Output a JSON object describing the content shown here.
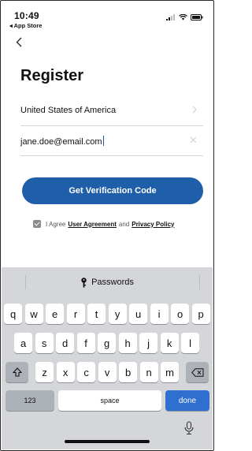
{
  "status_bar": {
    "time": "10:49",
    "back_app": "◂ App Store",
    "icons": [
      "signal-icon",
      "wifi-icon",
      "battery-icon"
    ]
  },
  "nav": {
    "back_icon": "chevron-left-icon"
  },
  "page": {
    "title": "Register"
  },
  "form": {
    "country": {
      "value": "United States of America",
      "trail_icon": "chevron-right-icon"
    },
    "email": {
      "value": "jane.doe@email.com",
      "trail_icon": "clear-icon"
    },
    "submit_label": "Get Verification Code"
  },
  "agreement": {
    "checked": true,
    "prefix": "I Agree",
    "link1": "User Agreement",
    "middle": "and",
    "link2": "Privacy Policy"
  },
  "keyboard": {
    "suggestion_bar": {
      "icon": "key-icon",
      "label": "Passwords"
    },
    "row1": [
      "q",
      "w",
      "e",
      "r",
      "t",
      "y",
      "u",
      "i",
      "o",
      "p"
    ],
    "row2": [
      "a",
      "s",
      "d",
      "f",
      "g",
      "h",
      "j",
      "k",
      "l"
    ],
    "row3": [
      "z",
      "x",
      "c",
      "v",
      "b",
      "n",
      "m"
    ],
    "numbers_key": "123",
    "space_key": "space",
    "done_key": "done",
    "icons": {
      "shift": "shift-icon",
      "delete": "backspace-icon",
      "dictation": "microphone-icon"
    }
  },
  "colors": {
    "primary": "#1f5ea8",
    "done_key": "#2e6fd0",
    "keyboard_bg": "#d4d6da"
  }
}
